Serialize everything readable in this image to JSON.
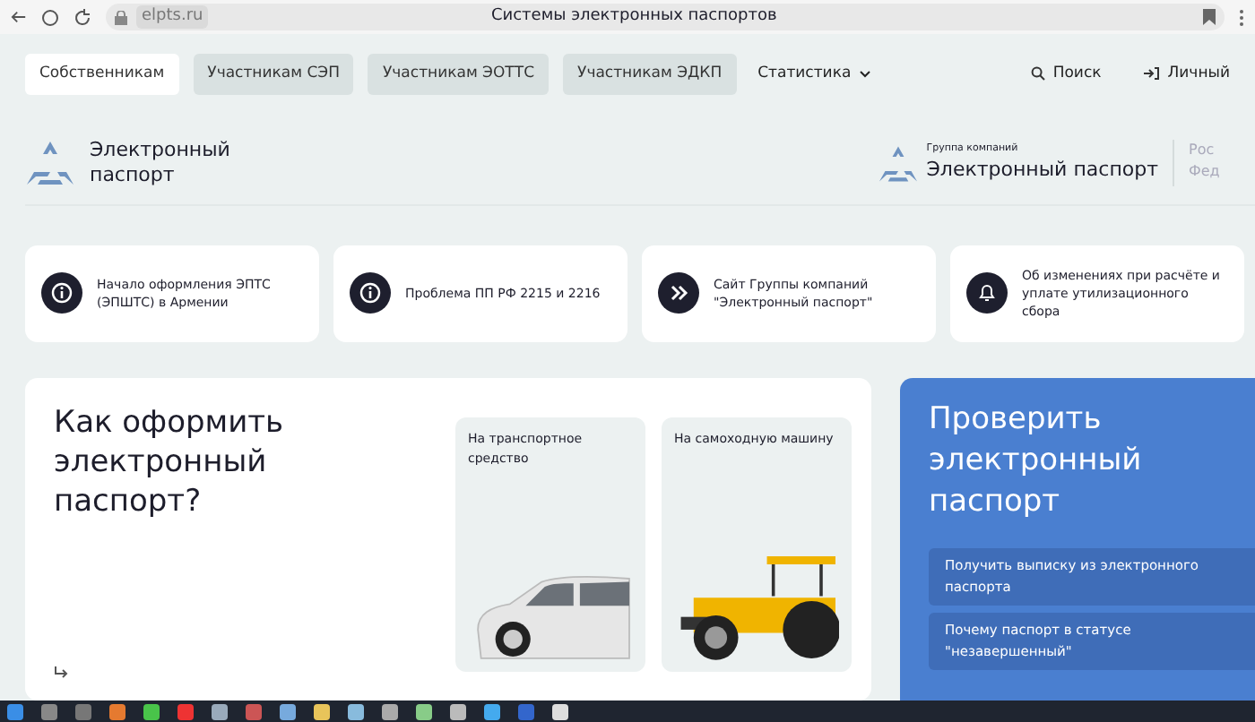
{
  "browser": {
    "address": "elpts.ru",
    "title": "Системы электронных паспортов"
  },
  "nav": {
    "tabs": [
      {
        "label": "Собственникам",
        "selected": true
      },
      {
        "label": "Участникам СЭП",
        "selected": false
      },
      {
        "label": "Участникам ЭОТТС",
        "selected": false
      },
      {
        "label": "Участникам ЭДКП",
        "selected": false
      }
    ],
    "dropdown": "Статистика",
    "search": "Поиск",
    "account": "Личный"
  },
  "logo": {
    "line1": "Электронный",
    "line2": "паспорт"
  },
  "group_logo": {
    "caption": "Группа компаний",
    "name": "Электронный паспорт",
    "cut_line1": "Рос",
    "cut_line2": "Фед"
  },
  "news": [
    {
      "kind": "info",
      "text": "Начало оформления ЭПТС (ЭПШТС) в Армении"
    },
    {
      "kind": "info",
      "text": "Проблема ПП РФ 2215 и 2216"
    },
    {
      "kind": "link",
      "text": "Сайт Группы компаний \"Электронный паспорт\""
    },
    {
      "kind": "notice",
      "text": "Об изменениях при расчёте и уплате утилизационного сбора"
    }
  ],
  "how": {
    "title": "Как оформить электронный паспорт?",
    "options": [
      {
        "kind": "car",
        "label": "На транспортное средство"
      },
      {
        "kind": "tractor",
        "label": "На самоходную машину"
      }
    ]
  },
  "check": {
    "title": "Проверить электронный паспорт",
    "links": [
      "Получить выписку из электронного паспорта",
      "Почему паспорт в статусе \"незавершенный\""
    ]
  }
}
